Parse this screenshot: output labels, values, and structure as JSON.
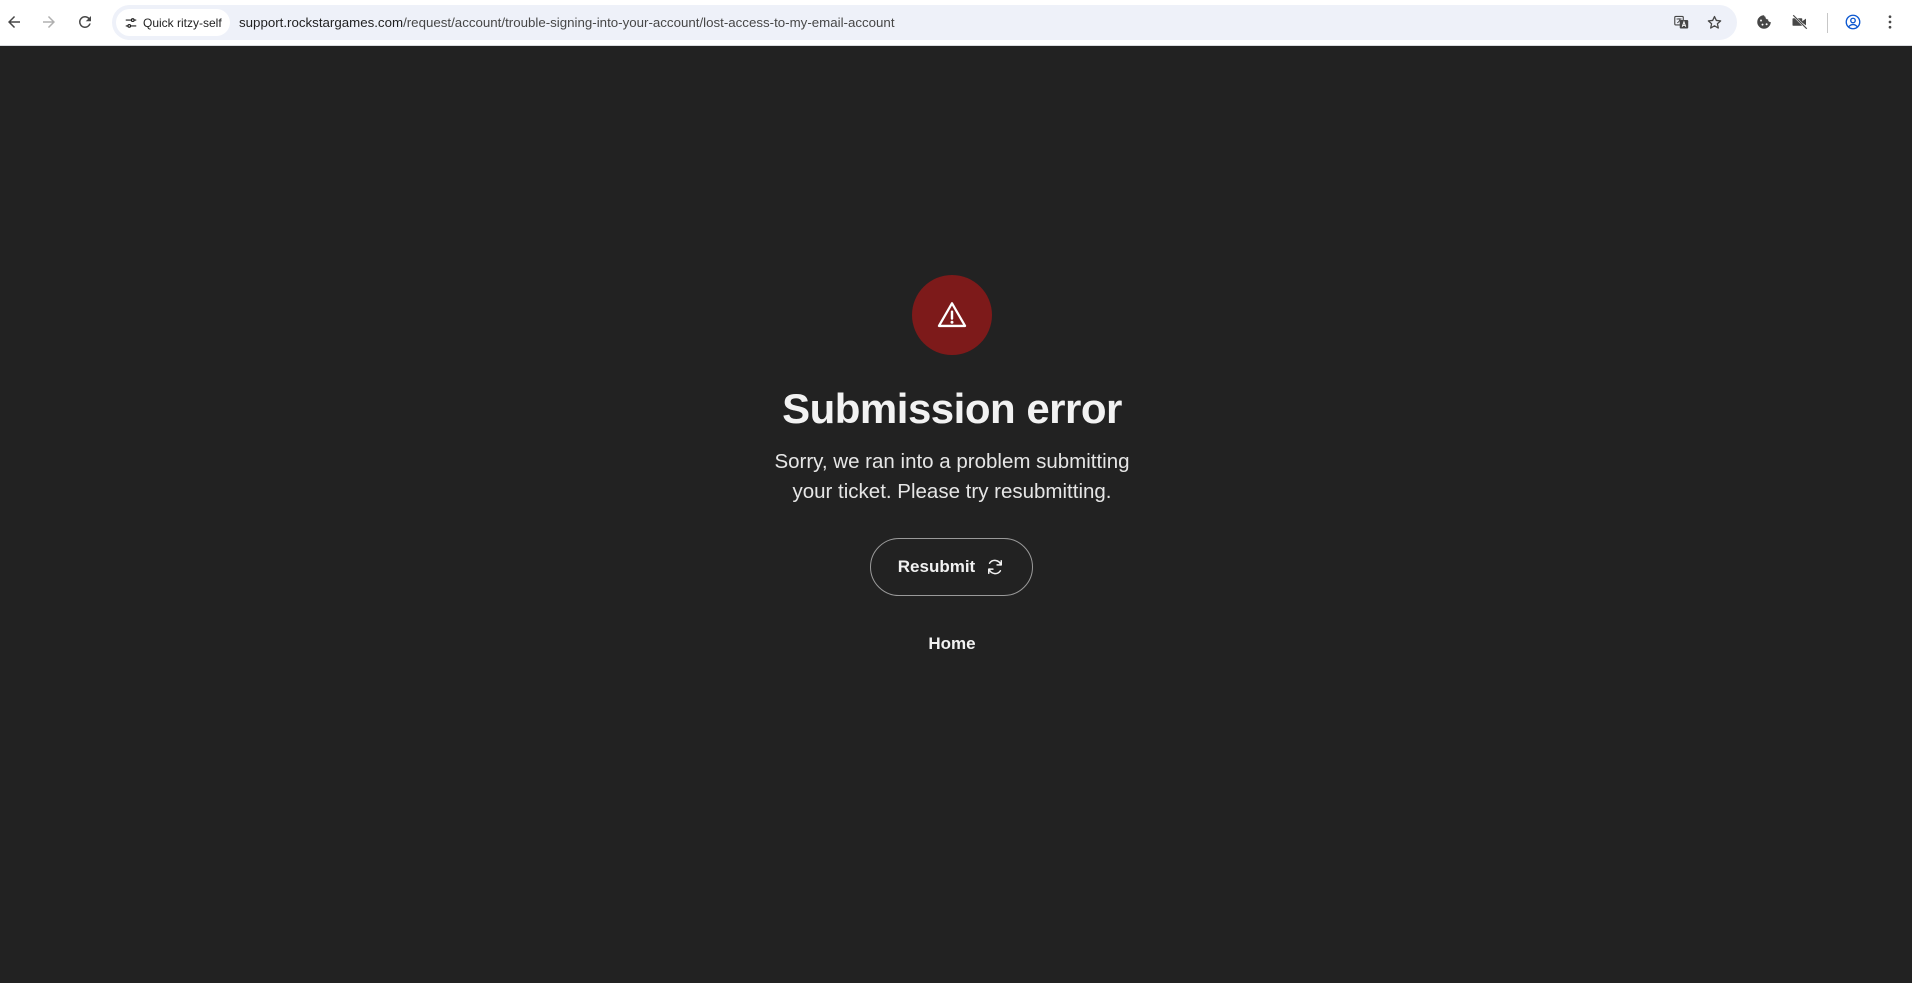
{
  "browser": {
    "site_chip_label": "Quick ritzy-self",
    "url_host": "support.rockstargames.com",
    "url_path": "/request/account/trouble-signing-into-your-account/lost-access-to-my-email-account"
  },
  "error": {
    "icon": "warning-triangle-icon",
    "icon_bg_color": "#7d1a1a",
    "title": "Submission error",
    "message": "Sorry, we ran into a problem submitting your ticket. Please try resubmitting.",
    "resubmit_label": "Resubmit",
    "home_label": "Home"
  },
  "colors": {
    "page_background": "#222222",
    "text": "#f2f2f2"
  }
}
